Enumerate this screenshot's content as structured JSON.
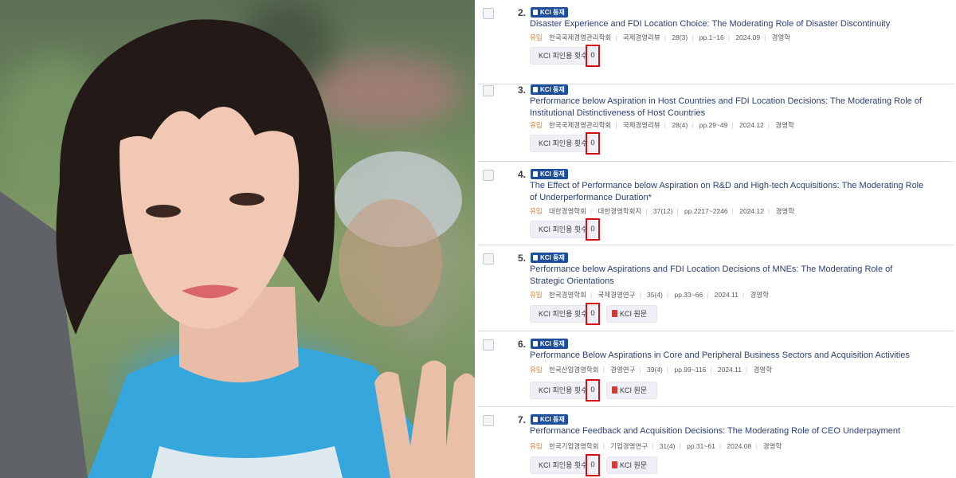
{
  "results": [
    {
      "number": "2.",
      "badge": "KCI 등재",
      "title": "Disaster Experience and FDI Location Choice: The Moderating Role of Disaster Discontinuity",
      "status": "유입",
      "society": "한국국제경영관리학회",
      "journal": "국제경영리뷰",
      "volume": "28(3)",
      "pages": "pp.1~16",
      "date": "2024.09",
      "field": "경영학",
      "cite_label": "KCI 피인용 횟수",
      "cite_count": "0",
      "full_text": ""
    },
    {
      "number": "3.",
      "badge": "KCI 등재",
      "title": "Performance below Aspiration in Host Countries and FDI Location Decisions: The Moderating Role of Institutional Distinctiveness of Host Countries",
      "status": "유입",
      "society": "한국국제경영관리학회",
      "journal": "국제경영리뷰",
      "volume": "28(4)",
      "pages": "pp.29~49",
      "date": "2024.12",
      "field": "경영학",
      "cite_label": "KCI 피인용 횟수",
      "cite_count": "0",
      "full_text": ""
    },
    {
      "number": "4.",
      "badge": "KCI 등재",
      "title": "The Effect of Performance below Aspiration on R&D and High-tech Acquisitions: The Moderating Role of Underperformance Duration*",
      "status": "유입",
      "society": "대한경영학회",
      "journal": "대한경영학회지",
      "volume": "37(12)",
      "pages": "pp.2217~2246",
      "date": "2024.12",
      "field": "경영학",
      "cite_label": "KCI 피인용 횟수",
      "cite_count": "0",
      "full_text": ""
    },
    {
      "number": "5.",
      "badge": "KCI 등재",
      "title": "Performance below Aspirations and FDI Location Decisions of MNEs: The Moderating Role of Strategic Orientations",
      "status": "유입",
      "society": "한국경영학회",
      "journal": "국제경영연구",
      "volume": "35(4)",
      "pages": "pp.33~66",
      "date": "2024.11",
      "field": "경영학",
      "cite_label": "KCI 피인용 횟수",
      "cite_count": "0",
      "full_text": "KCI 원문"
    },
    {
      "number": "6.",
      "badge": "KCI 등재",
      "title": "Performance Below Aspirations in Core and Peripheral Business Sectors and Acquisition Activities",
      "status": "유입",
      "society": "한국산업경영학회",
      "journal": "경영연구",
      "volume": "39(4)",
      "pages": "pp.99~116",
      "date": "2024.11",
      "field": "경영학",
      "cite_label": "KCI 피인용 횟수",
      "cite_count": "0",
      "full_text": "KCI 원문"
    },
    {
      "number": "7.",
      "badge": "KCI 등재",
      "title": "Performance Feedback and Acquisition Decisions: The Moderating Role of CEO Underpayment",
      "status": "유입",
      "society": "한국기업경영학회",
      "journal": "기업경영연구",
      "volume": "31(4)",
      "pages": "pp.31~61",
      "date": "2024.08",
      "field": "경영학",
      "cite_label": "KCI 피인용 횟수",
      "cite_count": "0",
      "full_text": "KCI 원문"
    }
  ]
}
